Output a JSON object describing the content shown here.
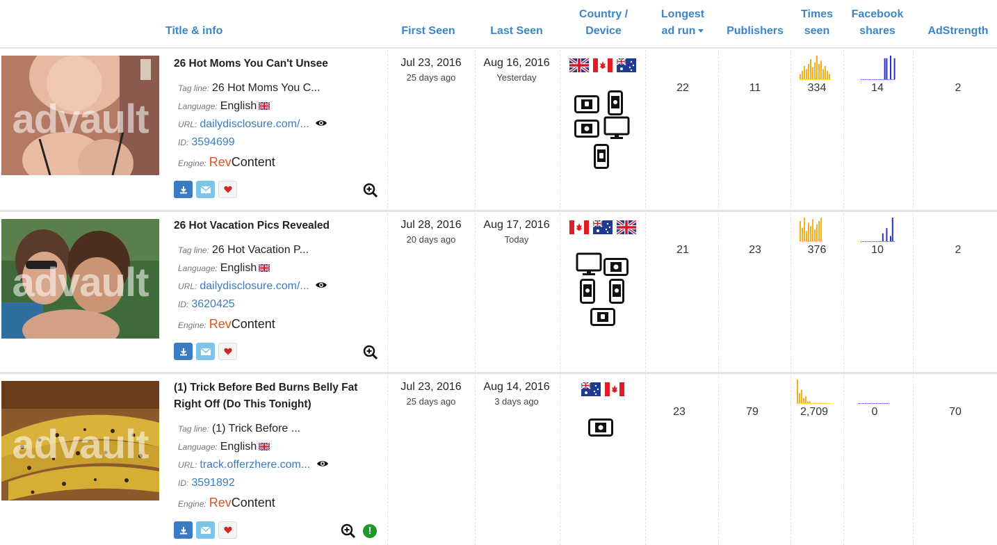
{
  "header": {
    "title_info": "Title & info",
    "first_seen": "First Seen",
    "last_seen": "Last Seen",
    "country": "Country /",
    "device": "Device",
    "longest": "Longest",
    "ad_run": "ad run",
    "publishers": "Publishers",
    "times": "Times",
    "seen": "seen",
    "facebook": "Facebook",
    "shares": "shares",
    "adstrength": "AdStrength"
  },
  "labels": {
    "tagline": "Tag line:",
    "language": "Language:",
    "url": "URL:",
    "id": "ID:",
    "engine": "Engine:",
    "watermark": "advault"
  },
  "rows": [
    {
      "title_line1": "26 Hot Moms You Can't Unsee",
      "title_line2": "",
      "tagline": "26 Hot Moms You C...",
      "language": "English",
      "url": "dailydisclosure.com/...",
      "id": "3594699",
      "engine_a": "Rev",
      "engine_b": "Content",
      "first_seen": "Jul 23, 2016",
      "first_seen_ago": "25 days ago",
      "last_seen": "Aug 16, 2016",
      "last_seen_ago": "Yesterday",
      "flags": [
        "uk-flag",
        "canada-flag",
        "australia-flag"
      ],
      "devices": [
        "android-tablet-icon",
        "apple-phone-icon",
        "apple-tablet-icon",
        "desktop-icon",
        "android-phone-icon"
      ],
      "longest_ad_run": "22",
      "publishers": "11",
      "times_seen": "334",
      "facebook_shares": "14",
      "adstrength": "2",
      "times_spark": [
        3,
        5,
        8,
        6,
        9,
        12,
        7,
        10,
        14,
        9,
        11,
        6,
        8,
        5,
        3
      ],
      "fb_spark": [
        0,
        0,
        0,
        0,
        0,
        0,
        0,
        0,
        0,
        0,
        0,
        0,
        8,
        8,
        0,
        9,
        0,
        8
      ],
      "has_alert": false
    },
    {
      "title_line1": "26 Hot Vacation Pics Revealed",
      "title_line2": "",
      "tagline": "26 Hot Vacation P...",
      "language": "English",
      "url": "dailydisclosure.com/...",
      "id": "3620425",
      "engine_a": "Rev",
      "engine_b": "Content",
      "first_seen": "Jul 28, 2016",
      "first_seen_ago": "20 days ago",
      "last_seen": "Aug 17, 2016",
      "last_seen_ago": "Today",
      "flags": [
        "canada-flag",
        "australia-flag",
        "uk-flag"
      ],
      "devices": [
        "desktop-icon",
        "apple-tablet-icon",
        "apple-phone-icon",
        "apple-phone-icon",
        "android-tablet-icon"
      ],
      "longest_ad_run": "21",
      "publishers": "23",
      "times_seen": "376",
      "facebook_shares": "10",
      "adstrength": "2",
      "times_spark": [
        12,
        8,
        14,
        6,
        11,
        9,
        13,
        7,
        10,
        12,
        14
      ],
      "fb_spark": [
        0,
        0,
        0,
        0,
        0,
        0,
        0,
        0,
        0,
        0,
        0,
        3,
        0,
        5,
        0,
        2,
        9,
        0,
        4
      ],
      "has_alert": false
    },
    {
      "title_line1": "(1) Trick Before Bed Burns Belly Fat",
      "title_line2": "Right Off (Do This Tonight)",
      "tagline": "(1) Trick Before ...",
      "language": "English",
      "url": "track.offerzhere.com...",
      "id": "3591892",
      "engine_a": "Rev",
      "engine_b": "Content",
      "first_seen": "Jul 23, 2016",
      "first_seen_ago": "25 days ago",
      "last_seen": "Aug 14, 2016",
      "last_seen_ago": "3 days ago",
      "flags": [
        "australia-flag",
        "canada-flag"
      ],
      "devices": [
        "apple-tablet-icon"
      ],
      "longest_ad_run": "23",
      "publishers": "79",
      "times_seen": "2,709",
      "facebook_shares": "0",
      "adstrength": "70",
      "times_spark": [
        14,
        6,
        8,
        3,
        4,
        1,
        1,
        0,
        0,
        0,
        0,
        0,
        0,
        0,
        0,
        0,
        0
      ],
      "fb_spark": [
        0,
        0,
        0,
        0,
        0,
        0,
        0,
        0,
        0,
        0,
        0,
        0,
        0,
        0,
        0,
        0
      ],
      "has_alert": true
    }
  ],
  "colors": {
    "link": "#3a86c8",
    "times_bars": "#f2b01e",
    "fb_bars": "#2233cc",
    "rev": "#e0531c",
    "alert": "#1b9a2b"
  }
}
